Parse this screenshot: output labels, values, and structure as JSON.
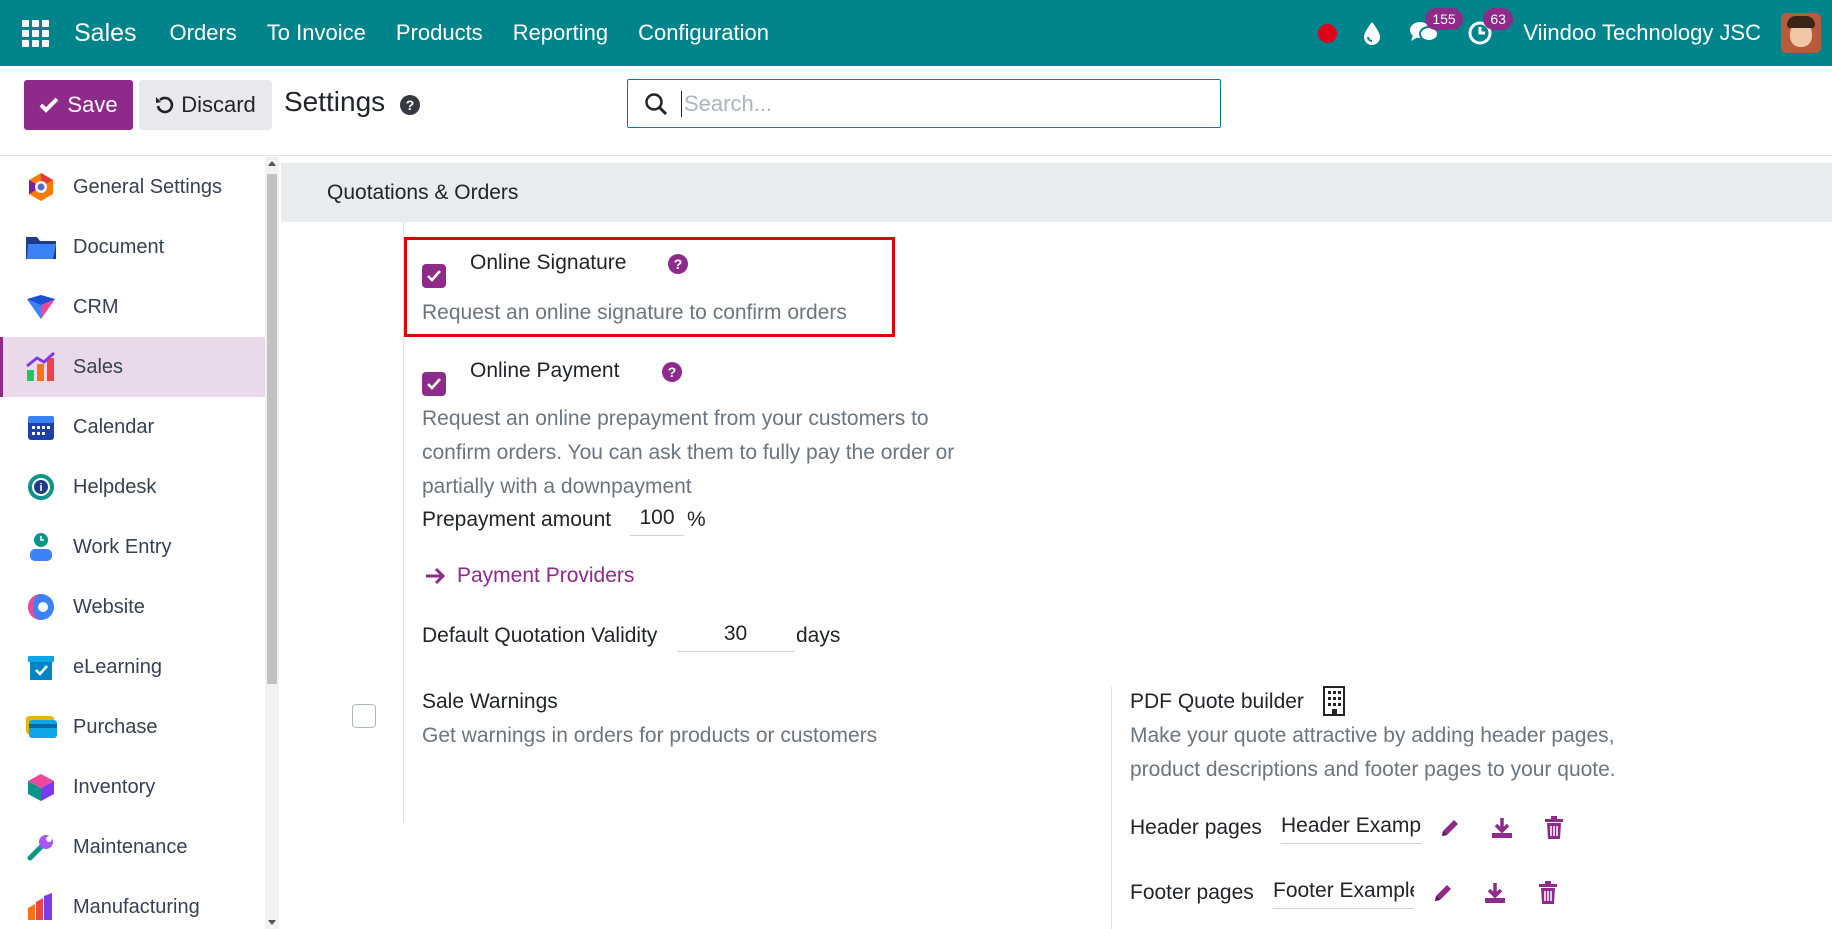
{
  "navbar": {
    "app_name": "Sales",
    "menu": [
      "Orders",
      "To Invoice",
      "Products",
      "Reporting",
      "Configuration"
    ],
    "messages_count": "155",
    "activities_count": "63",
    "company": "Viindoo Technology JSC",
    "bg_color": "#00848c"
  },
  "control": {
    "save_label": "Save",
    "discard_label": "Discard",
    "title": "Settings",
    "search_placeholder": "Search..."
  },
  "sidebar": {
    "items": [
      {
        "label": "General Settings",
        "icon": "general-settings-icon"
      },
      {
        "label": "Document",
        "icon": "folder-icon"
      },
      {
        "label": "CRM",
        "icon": "crm-icon"
      },
      {
        "label": "Sales",
        "icon": "sales-chart-icon",
        "active": true
      },
      {
        "label": "Calendar",
        "icon": "calendar-icon"
      },
      {
        "label": "Helpdesk",
        "icon": "helpdesk-icon"
      },
      {
        "label": "Work Entry",
        "icon": "work-entry-icon"
      },
      {
        "label": "Website",
        "icon": "website-icon"
      },
      {
        "label": "eLearning",
        "icon": "elearning-icon"
      },
      {
        "label": "Purchase",
        "icon": "purchase-icon"
      },
      {
        "label": "Inventory",
        "icon": "inventory-icon"
      },
      {
        "label": "Maintenance",
        "icon": "maintenance-icon"
      },
      {
        "label": "Manufacturing",
        "icon": "manufacturing-icon"
      }
    ]
  },
  "main": {
    "section_title": "Quotations & Orders",
    "online_signature": {
      "title": "Online Signature",
      "desc": "Request an online signature to confirm orders",
      "checked": true
    },
    "online_payment": {
      "title": "Online Payment",
      "desc_lines": [
        "Request an online prepayment from your customers to",
        "confirm orders. You can ask them to fully pay the order or",
        "partially with a downpayment"
      ],
      "checked": true,
      "prepayment_label": "Prepayment amount",
      "prepayment_value": "100",
      "prepayment_unit": "%",
      "providers_link": "Payment Providers"
    },
    "validity": {
      "label": "Default Quotation Validity",
      "value": "30",
      "unit": "days"
    },
    "sale_warnings": {
      "title": "Sale Warnings",
      "desc": "Get warnings in orders for products or customers",
      "checked": false
    },
    "pdf_quote": {
      "title": "PDF Quote builder",
      "desc_lines": [
        "Make your quote attractive by adding header pages,",
        "product descriptions and footer pages to your quote."
      ],
      "header_label": "Header pages",
      "header_value": "Header Example.pdf",
      "footer_label": "Footer pages",
      "footer_value": "Footer Example.pdf"
    }
  },
  "colors": {
    "accent": "#8e2a8a",
    "highlight": "#e00000"
  }
}
